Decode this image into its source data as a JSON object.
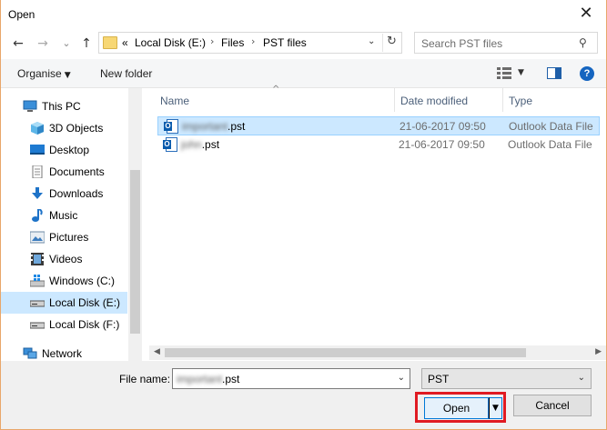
{
  "window": {
    "title": "Open",
    "close_glyph": "✕"
  },
  "nav": {
    "back_glyph": "←",
    "forward_glyph": "→",
    "history_glyph": "⌄",
    "up_glyph": "↑",
    "address": {
      "overflow": "«",
      "segments": [
        "Local Disk (E:)",
        "Files",
        "PST files"
      ],
      "separator": "›"
    },
    "search": {
      "placeholder": "Search PST files"
    }
  },
  "toolbar": {
    "organise_label": "Organise",
    "new_folder_label": "New folder",
    "help_label": "?"
  },
  "sidebar": {
    "items": [
      {
        "label": "This PC",
        "icon": "computer-icon"
      },
      {
        "label": "3D Objects",
        "icon": "cube-icon"
      },
      {
        "label": "Desktop",
        "icon": "desktop-icon"
      },
      {
        "label": "Documents",
        "icon": "documents-icon"
      },
      {
        "label": "Downloads",
        "icon": "download-icon"
      },
      {
        "label": "Music",
        "icon": "music-icon"
      },
      {
        "label": "Pictures",
        "icon": "pictures-icon"
      },
      {
        "label": "Videos",
        "icon": "videos-icon"
      },
      {
        "label": "Windows (C:)",
        "icon": "windows-drive-icon"
      },
      {
        "label": "Local Disk (E:)",
        "icon": "drive-icon",
        "selected": true
      },
      {
        "label": "Local Disk (F:)",
        "icon": "drive-icon"
      },
      {
        "label": "Network",
        "icon": "network-icon"
      }
    ]
  },
  "files": {
    "columns": [
      "Name",
      "Date modified",
      "Type"
    ],
    "rows": [
      {
        "name_blurred": "important",
        "ext": ".pst",
        "date": "21-06-2017 09:50",
        "type": "Outlook Data File",
        "selected": true
      },
      {
        "name_blurred": "john",
        "ext": ".pst",
        "date": "21-06-2017 09:50",
        "type": "Outlook Data File",
        "selected": false
      }
    ]
  },
  "bottom": {
    "file_name_label": "File name:",
    "file_name_blurred": "important",
    "file_name_ext": ".pst",
    "filter_value": "PST",
    "open_label": "Open",
    "cancel_label": "Cancel"
  },
  "colors": {
    "selection": "#cce8ff",
    "highlight_border": "#e01a22",
    "accent": "#0078d7"
  }
}
